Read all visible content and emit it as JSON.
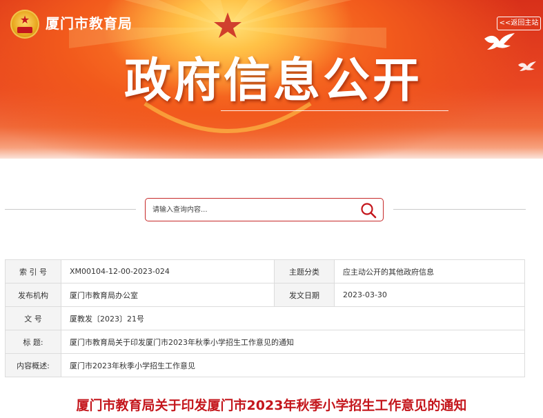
{
  "header": {
    "site_name": "厦门市教育局",
    "back_label": "<<返回主站",
    "banner_title": "政府信息公开"
  },
  "search": {
    "placeholder": "请输入查询内容..."
  },
  "info": {
    "index_label": "索 引 号",
    "index_value": "XM00104-12-00-2023-024",
    "category_label": "主题分类",
    "category_value": "应主动公开的其他政府信息",
    "publisher_label": "发布机构",
    "publisher_value": "厦门市教育局办公室",
    "date_label": "发文日期",
    "date_value": "2023-03-30",
    "docno_label": "文 号",
    "docno_value": "厦教发〔2023〕21号",
    "title_label": "标 题:",
    "title_value": "厦门市教育局关于印发厦门市2023年秋季小学招生工作意见的通知",
    "summary_label": "内容概述:",
    "summary_value": "厦门市2023年秋季小学招生工作意见"
  },
  "document": {
    "title": "厦门市教育局关于印发厦门市2023年秋季小学招生工作意见的通知"
  },
  "colors": {
    "accent": "#c4161c",
    "banner_red": "#e94722",
    "border": "#dcdcdc"
  }
}
